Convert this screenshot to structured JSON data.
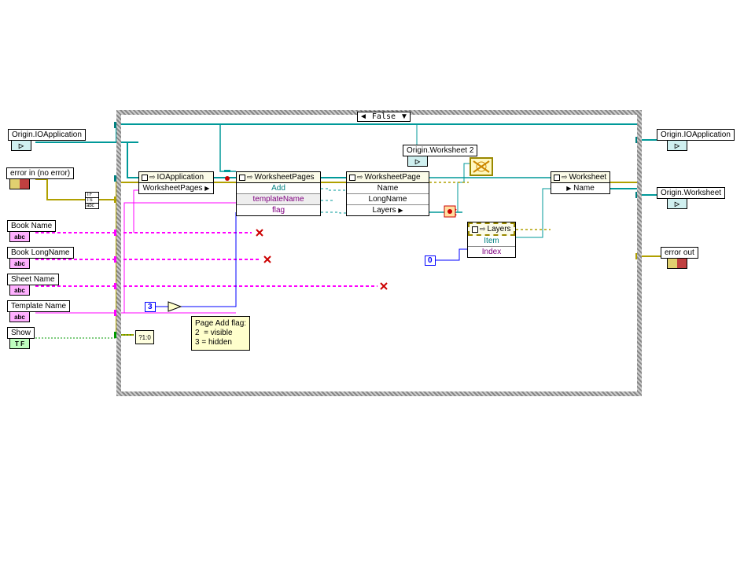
{
  "case": {
    "selector_value": "False",
    "left_arrow": "◄",
    "right_arrow": "▼"
  },
  "inputs": {
    "ioapp": {
      "label": "Origin.IOApplication"
    },
    "err_in": {
      "label": "error in (no error)"
    },
    "book_name": {
      "label": "Book Name",
      "glyph": "abc"
    },
    "book_longname": {
      "label": "Book LongName",
      "glyph": "abc"
    },
    "sheet_name": {
      "label": "Sheet Name",
      "glyph": "abc"
    },
    "template_name": {
      "label": "Template Name",
      "glyph": "abc"
    },
    "show": {
      "label": "Show",
      "glyph": "T F"
    }
  },
  "outputs": {
    "ioapp": {
      "label": "Origin.IOApplication"
    },
    "worksheet": {
      "label": "Origin.Worksheet"
    },
    "err_out": {
      "label": "error out"
    }
  },
  "nodes": {
    "ioapp_prop": {
      "title": "IOApplication",
      "row1": "WorksheetPages"
    },
    "wp_add": {
      "title": "WorksheetPages",
      "r1": "Add",
      "r2": "templateName",
      "r3": "flag"
    },
    "wpage": {
      "title": "WorksheetPage",
      "r1": "Name",
      "r2": "LongName",
      "r3": "Layers"
    },
    "layers": {
      "title": "Layers",
      "r1": "Item",
      "r2": "Index"
    },
    "ws": {
      "title": "Worksheet",
      "r1": "Name"
    },
    "ws2_label": "Origin.Worksheet 2"
  },
  "unbundle": {
    "r1": "TF",
    "r2": "TS",
    "r3": "abc"
  },
  "consts": {
    "flag3": "3",
    "idx0": "0"
  },
  "select_label": "?1:0",
  "comment": "Page Add flag:\n2  = visible\n3 = hidden"
}
